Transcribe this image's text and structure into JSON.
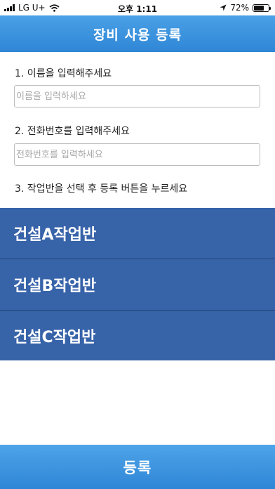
{
  "status_bar": {
    "carrier": "LG U+",
    "time": "오후 1:11",
    "battery_percent": "72%",
    "battery_level": 0.72
  },
  "header": {
    "title": "장비 사용 등록"
  },
  "form": {
    "name": {
      "label": "1. 이름을 입력해주세요",
      "placeholder": "이름을 입력하세요",
      "value": ""
    },
    "phone": {
      "label": "2. 전화번호를 입력해주세요",
      "placeholder": "전화번호를 입력하세요",
      "value": ""
    },
    "crew_instruction": "3. 작업반을 선택 후 등록 버튼을 누르세요"
  },
  "crews": [
    {
      "label": "건설A작업반"
    },
    {
      "label": "건설B작업반"
    },
    {
      "label": "건설C작업반"
    }
  ],
  "register_button": {
    "label": "등록"
  },
  "colors": {
    "header_blue": "#3a92dd",
    "crew_button": "#3763a9",
    "register_blue": "#3a92dd"
  },
  "icons": {
    "signal": "signal-bars-icon",
    "wifi": "wifi-icon",
    "location": "location-arrow-icon",
    "battery": "battery-icon"
  }
}
